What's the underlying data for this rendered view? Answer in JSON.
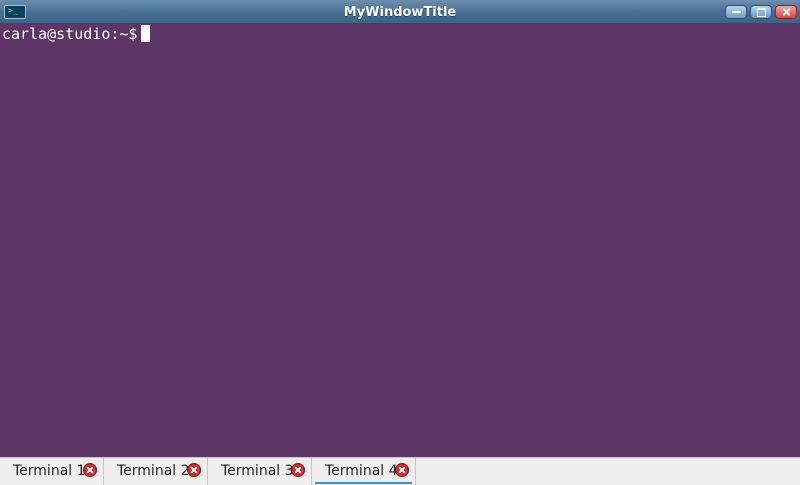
{
  "window": {
    "title": "MyWindowTitle",
    "icon": "terminal-icon",
    "controls": [
      "minimize-icon",
      "maximize-icon",
      "close-icon"
    ],
    "background_color": "#5d3566"
  },
  "terminal": {
    "prompt": "carla@studio:~$",
    "cursor": "block-cursor",
    "text_color": "#ffffff"
  },
  "tabs": [
    {
      "label": "Terminal 1",
      "active": false,
      "close_icon": "close-circle-icon"
    },
    {
      "label": "Terminal 2",
      "active": false,
      "close_icon": "close-circle-icon"
    },
    {
      "label": "Terminal 3",
      "active": false,
      "close_icon": "close-circle-icon"
    },
    {
      "label": "Terminal 4",
      "active": true,
      "close_icon": "close-circle-icon"
    }
  ],
  "colors": {
    "active_tab_indicator": "#3d8fd1",
    "tab_close": "#d32b2b"
  }
}
